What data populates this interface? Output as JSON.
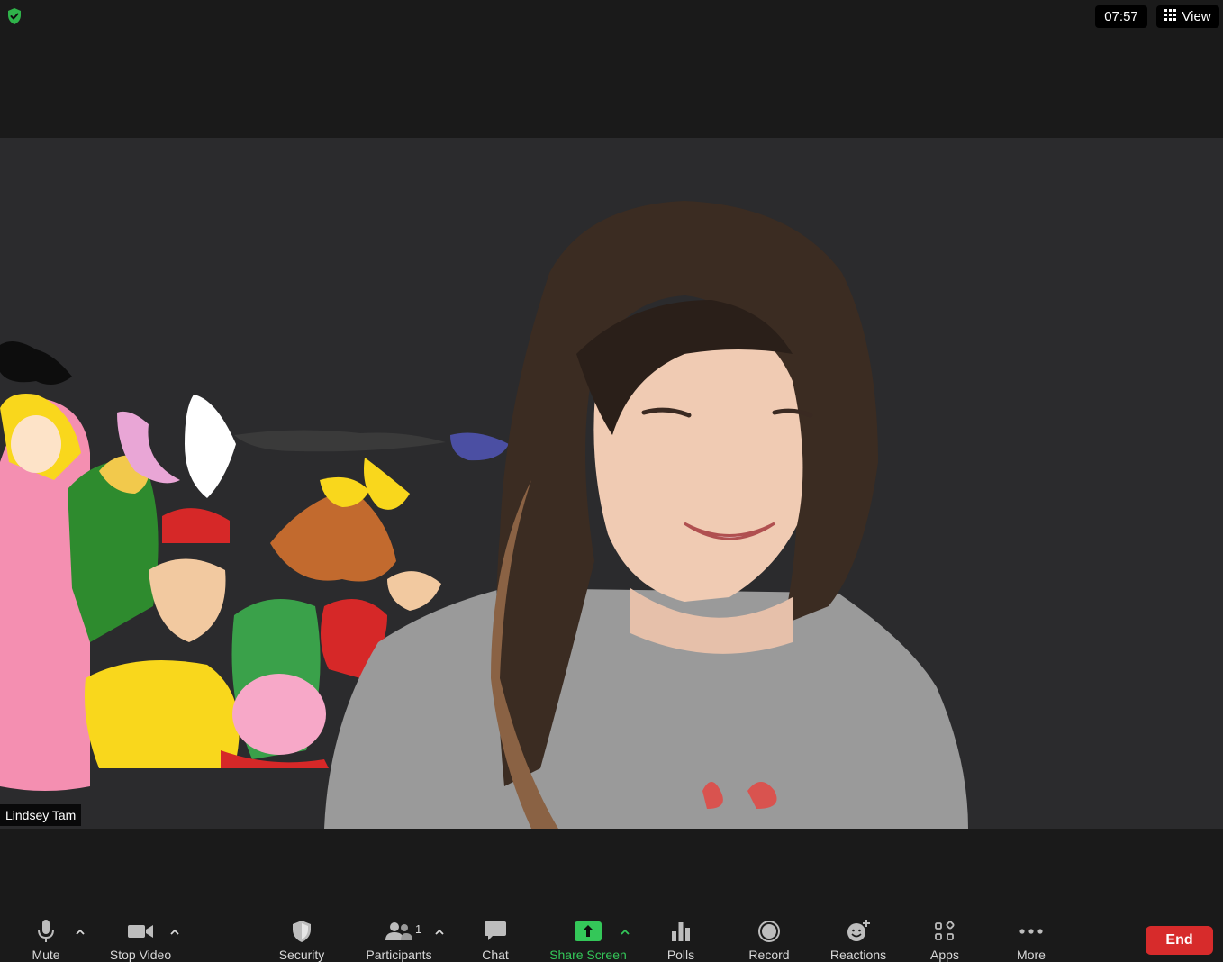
{
  "top_bar": {
    "time": "07:57",
    "view_label": "View",
    "security_icon": "shield-check-icon"
  },
  "video": {
    "participant_name": "Lindsey Tam"
  },
  "toolbar": {
    "mute_label": "Mute",
    "stop_video_label": "Stop Video",
    "security_label": "Security",
    "participants_label": "Participants",
    "participants_count": "1",
    "chat_label": "Chat",
    "share_screen_label": "Share Screen",
    "polls_label": "Polls",
    "record_label": "Record",
    "reactions_label": "Reactions",
    "apps_label": "Apps",
    "more_label": "More",
    "end_label": "End"
  },
  "colors": {
    "share_green": "#34c759",
    "end_red": "#d72b2b",
    "security_green": "#2fb34a"
  }
}
